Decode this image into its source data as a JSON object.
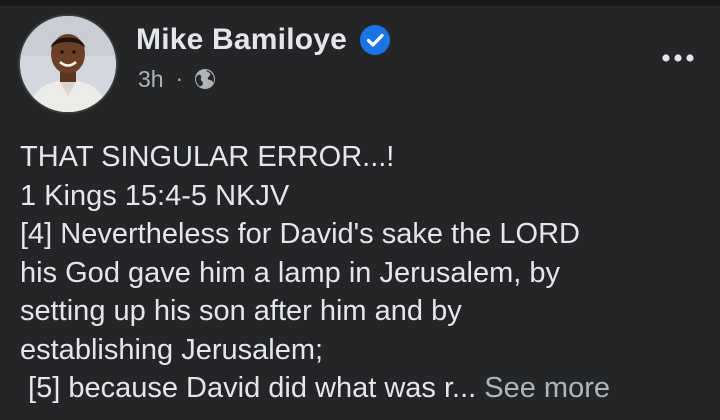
{
  "post": {
    "author": {
      "name": "Mike Bamiloye",
      "verified": true
    },
    "meta": {
      "time": "3h",
      "separator": "·",
      "audience_icon": "globe-icon"
    },
    "more_icon": "more-options-icon",
    "body_lines": [
      "THAT SINGULAR ERROR...!",
      "1 Kings 15:4-5 NKJV",
      "[4] Nevertheless for David's sake the LORD",
      "his God gave him a lamp in Jerusalem, by",
      "setting up his son after him and by",
      "establishing Jerusalem;"
    ],
    "truncated_line": " [5] because David did what was r...",
    "see_more_label": "See more"
  },
  "colors": {
    "background": "#242526",
    "primary_text": "#e4e6eb",
    "secondary_text": "#b0b3b8",
    "verified_blue": "#1b74e4"
  }
}
